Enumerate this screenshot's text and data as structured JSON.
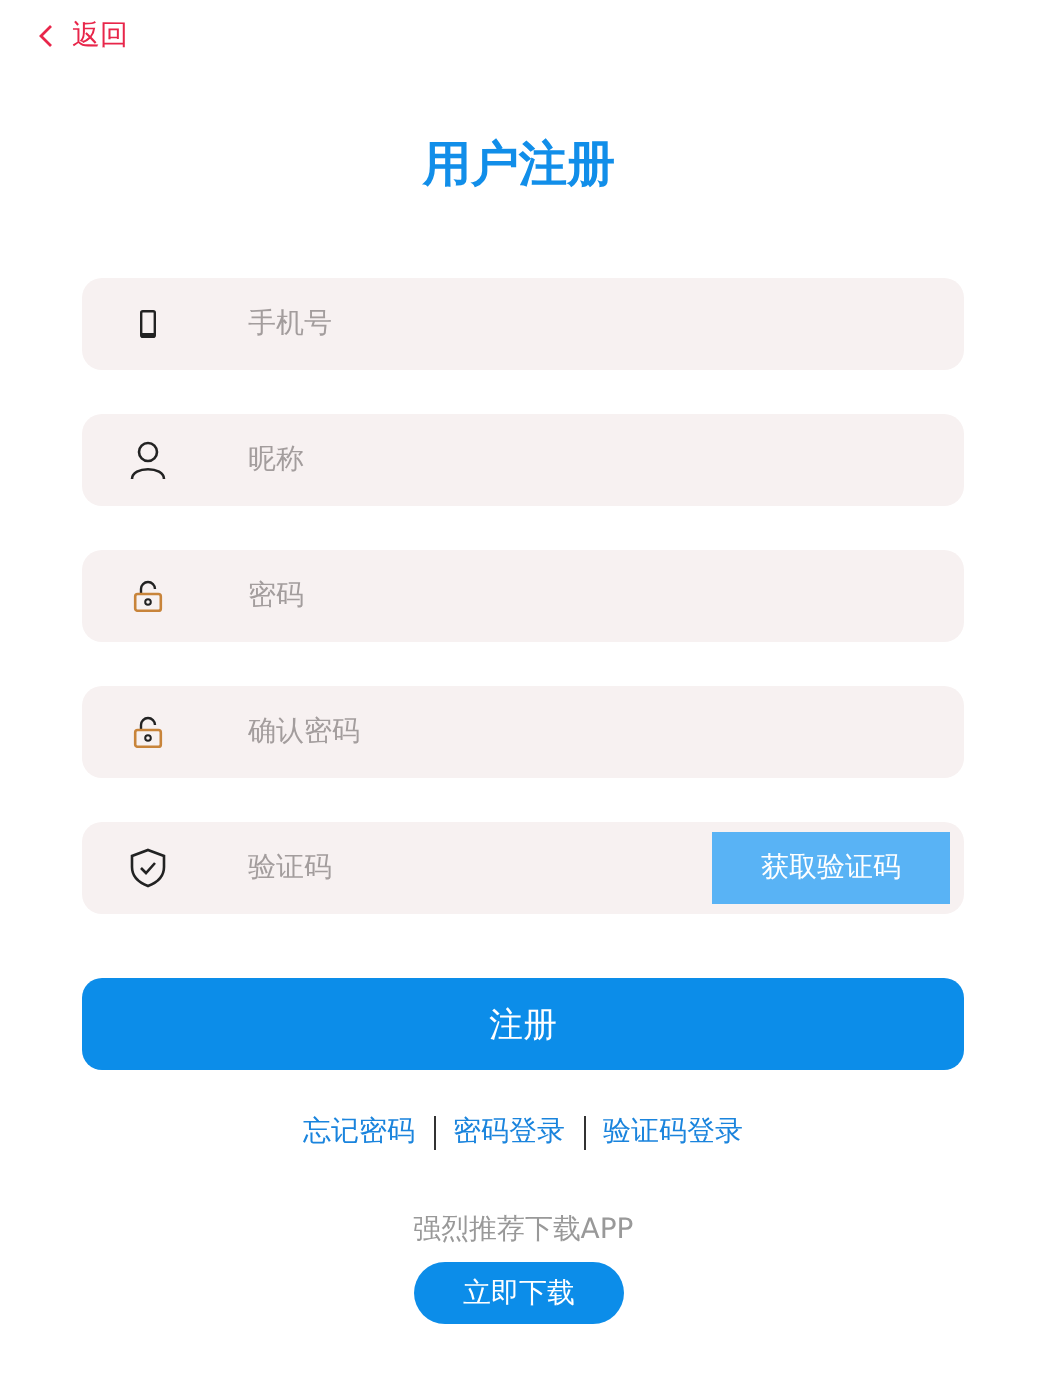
{
  "back": {
    "label": "返回"
  },
  "title": "用户注册",
  "fields": [
    {
      "kind": "phone",
      "placeholder": "手机号"
    },
    {
      "kind": "user",
      "placeholder": "昵称"
    },
    {
      "kind": "password",
      "placeholder": "密码"
    },
    {
      "kind": "password",
      "placeholder": "确认密码"
    },
    {
      "kind": "code",
      "placeholder": "验证码",
      "button": "获取验证码"
    }
  ],
  "submit": "注册",
  "links": [
    "忘记密码",
    "密码登录",
    "验证码登录"
  ],
  "promo": {
    "text": "强烈推荐下载APP",
    "button": "立即下载"
  }
}
